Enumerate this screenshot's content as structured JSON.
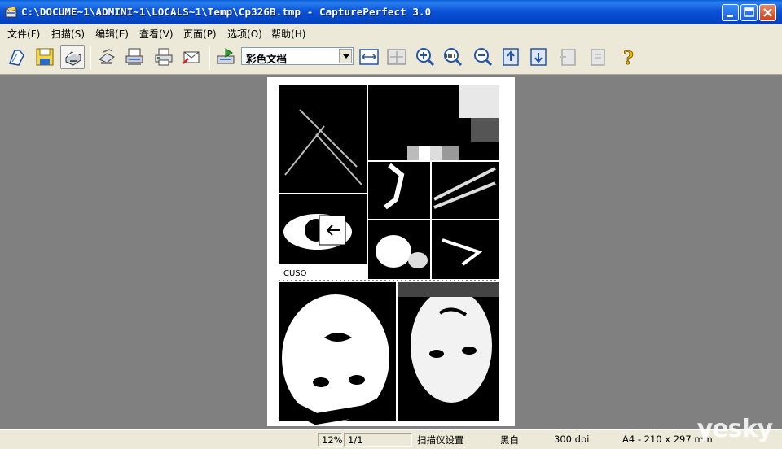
{
  "window": {
    "title": "C:\\DOCUME~1\\ADMINI~1\\LOCALS~1\\Temp\\Cp326B.tmp - CapturePerfect 3.0"
  },
  "menu": [
    {
      "label": "文件",
      "key": "(F)",
      "hot": "F"
    },
    {
      "label": "扫描",
      "key": "(S)",
      "hot": "S"
    },
    {
      "label": "编辑",
      "key": "(E)",
      "hot": "E"
    },
    {
      "label": "查看",
      "key": "(V)",
      "hot": "V"
    },
    {
      "label": "页面",
      "key": "(P)",
      "hot": "P"
    },
    {
      "label": "选项",
      "key": "(O)",
      "hot": "O"
    },
    {
      "label": "帮助",
      "key": "(H)",
      "hot": "H"
    }
  ],
  "toolbar": {
    "scan_mode_value": "彩色文档",
    "icons": [
      "open-folder-icon",
      "save-disk-icon",
      "scan-icon",
      "scan-batch-icon",
      "scan-page-icon",
      "print-icon",
      "email-icon",
      "scan-to-app-icon",
      "fit-width-icon",
      "fit-page-icon",
      "zoom-in-icon",
      "zoom-100-icon",
      "zoom-out-icon",
      "prev-page-icon",
      "next-page-icon",
      "insert-page-icon",
      "delete-page-icon",
      "help-icon"
    ]
  },
  "status": {
    "zoom": "12%",
    "page": "1/1",
    "scanner_settings": "扫描仪设置",
    "color_mode": "黑白",
    "dpi": "300 dpi",
    "paper": "A4 - 210 x 297 mm"
  },
  "watermark": "yesky"
}
